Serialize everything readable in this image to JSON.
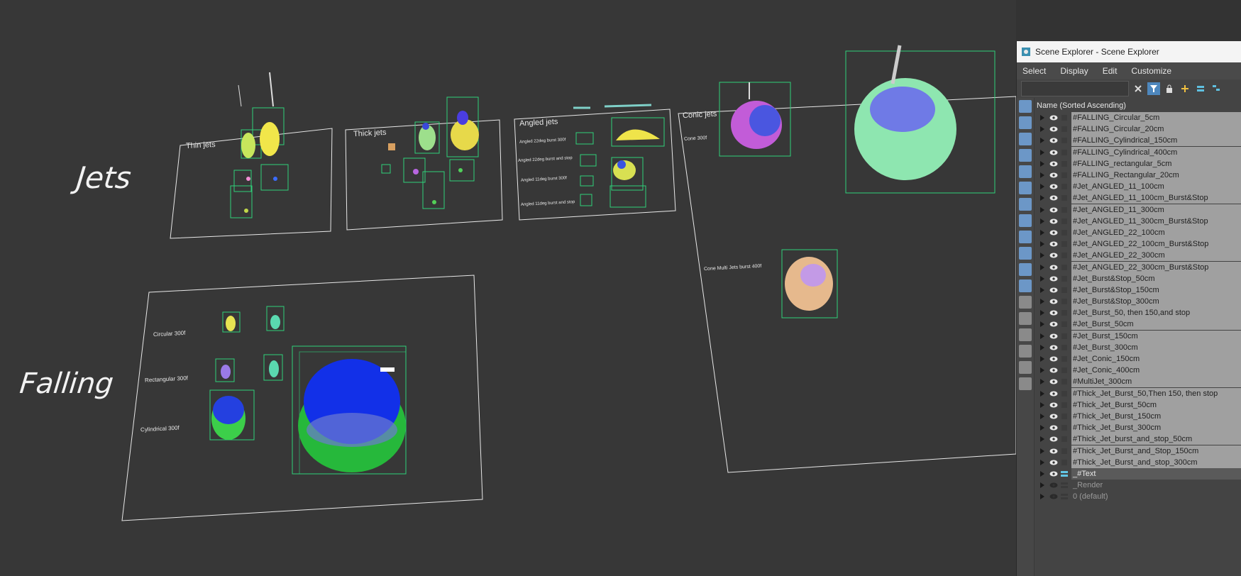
{
  "viewport": {
    "label_jets": "Jets",
    "label_falling": "Falling",
    "panel_thin_jets": "Thin jets",
    "panel_thick_jets": "Thick  jets",
    "panel_angled_jets": "Angled jets",
    "panel_conic_jets": "Conic jets",
    "angled_label_1": "Angled 22deg burst 300f",
    "angled_label_2": "Angled 22deg burst and stop",
    "angled_label_3": "Angled 11deg burst 300f",
    "angled_label_4": "Angled 11deg burst and stop",
    "conic_label_1": "Cone 300f",
    "conic_label_2": "Cone Multi Jets burst 400f",
    "falling_label_1": "Circular 300f",
    "falling_label_2": "Rectangular 300f",
    "falling_label_3": "Cylindrical 300f"
  },
  "explorer": {
    "title": "Scene Explorer - Scene Explorer",
    "menu": [
      "Select",
      "Display",
      "Edit",
      "Customize"
    ],
    "search_placeholder": "",
    "column_header": "Name (Sorted Ascending)",
    "items": [
      {
        "name": "#FALLING_Circular_5cm",
        "kind": "obj"
      },
      {
        "name": "#FALLING_Circular_20cm",
        "kind": "obj"
      },
      {
        "name": "#FALLING_Cylindrical_150cm",
        "kind": "obj"
      },
      {
        "name": "#FALLING_Cylindrical_400cm",
        "kind": "obj"
      },
      {
        "name": "#FALLING_rectangular_5cm",
        "kind": "obj"
      },
      {
        "name": "#FALLING_Rectangular_20cm",
        "kind": "obj"
      },
      {
        "name": "#Jet_ANGLED_11_100cm",
        "kind": "obj"
      },
      {
        "name": "#Jet_ANGLED_11_100cm_Burst&Stop",
        "kind": "obj"
      },
      {
        "name": "#Jet_ANGLED_11_300cm",
        "kind": "obj"
      },
      {
        "name": "#Jet_ANGLED_11_300cm_Burst&Stop",
        "kind": "obj"
      },
      {
        "name": "#Jet_ANGLED_22_100cm",
        "kind": "obj"
      },
      {
        "name": "#Jet_ANGLED_22_100cm_Burst&Stop",
        "kind": "obj"
      },
      {
        "name": "#Jet_ANGLED_22_300cm",
        "kind": "obj"
      },
      {
        "name": "#Jet_ANGLED_22_300cm_Burst&Stop",
        "kind": "obj"
      },
      {
        "name": "#Jet_Burst&Stop_50cm",
        "kind": "obj"
      },
      {
        "name": "#Jet_Burst&Stop_150cm",
        "kind": "obj"
      },
      {
        "name": "#Jet_Burst&Stop_300cm",
        "kind": "obj"
      },
      {
        "name": "#Jet_Burst_50, then 150,and stop",
        "kind": "obj"
      },
      {
        "name": "#Jet_Burst_50cm",
        "kind": "obj"
      },
      {
        "name": "#Jet_Burst_150cm",
        "kind": "obj"
      },
      {
        "name": "#Jet_Burst_300cm",
        "kind": "obj"
      },
      {
        "name": "#Jet_Conic_150cm",
        "kind": "obj"
      },
      {
        "name": "#Jet_Conic_400cm",
        "kind": "obj"
      },
      {
        "name": "#MultiJet_300cm",
        "kind": "obj"
      },
      {
        "name": "#Thick_Jet_Burst_50,Then 150, then stop",
        "kind": "obj"
      },
      {
        "name": "#Thick_Jet_Burst_50cm",
        "kind": "obj"
      },
      {
        "name": "#Thick_Jet_Burst_150cm",
        "kind": "obj"
      },
      {
        "name": "#Thick_Jet_Burst_300cm",
        "kind": "obj"
      },
      {
        "name": "#Thick_Jet_burst_and_stop_50cm",
        "kind": "obj"
      },
      {
        "name": "#Thick_Jet_Burst_and_Stop_150cm",
        "kind": "obj"
      },
      {
        "name": "#Thick_Jet_Burst_and_stop_300cm",
        "kind": "obj"
      },
      {
        "name": "_#Text",
        "kind": "layer"
      },
      {
        "name": "_Render",
        "kind": "hidden"
      },
      {
        "name": "0 (default)",
        "kind": "hidden"
      }
    ]
  },
  "colors": {
    "viewport_bg": "#373737",
    "bbox_green": "#2fd07a",
    "selection_blue": "#4e87bd"
  }
}
